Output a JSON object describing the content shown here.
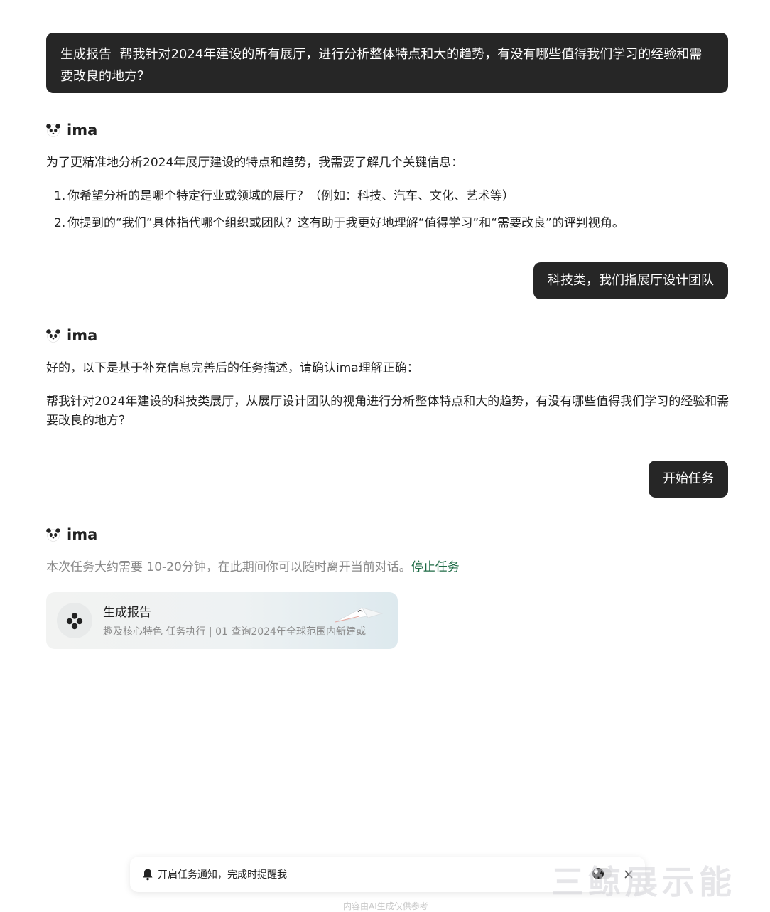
{
  "messages": {
    "user1": {
      "tag": "生成报告",
      "text": "帮我针对2024年建设的所有展厅，进行分析整体特点和大的趋势，有没有哪些值得我们学习的经验和需要改良的地方？"
    },
    "ai_name": "ima",
    "ai1": {
      "intro": "为了更精准地分析2024年展厅建设的特点和趋势，我需要了解几个关键信息：",
      "questions": [
        {
          "num": "1.",
          "text": "你希望分析的是哪个特定行业或领域的展厅？（例如：科技、汽车、文化、艺术等）"
        },
        {
          "num": "2.",
          "text": "你提到的“我们”具体指代哪个组织或团队？这有助于我更好地理解“值得学习”和“需要改良”的评判视角。"
        }
      ]
    },
    "user2": "科技类，我们指展厅设计团队",
    "ai2": {
      "intro": "好的，以下是基于补充信息完善后的任务描述，请确认ima理解正确：",
      "task": "帮我针对2024年建设的科技类展厅，从展厅设计团队的视角进行分析整体特点和大的趋势，有没有哪些值得我们学习的经验和需要改良的地方？"
    },
    "user3": "开始任务",
    "ai3": {
      "status": "本次任务大约需要 10-20分钟，在此期间你可以随时离开当前对话。",
      "stop": "停止任务"
    }
  },
  "task_card": {
    "title": "生成报告",
    "subtitle": "趣及核心特色    任务执行 | 01 查询2024年全球范围内新建或",
    "icon": "flower-dots-icon"
  },
  "notification": {
    "text": "开启任务通知，完成时提醒我",
    "toggle_on": false
  },
  "watermark": "三鲸展示能",
  "footer": "内容由AI生成仅供参考"
}
